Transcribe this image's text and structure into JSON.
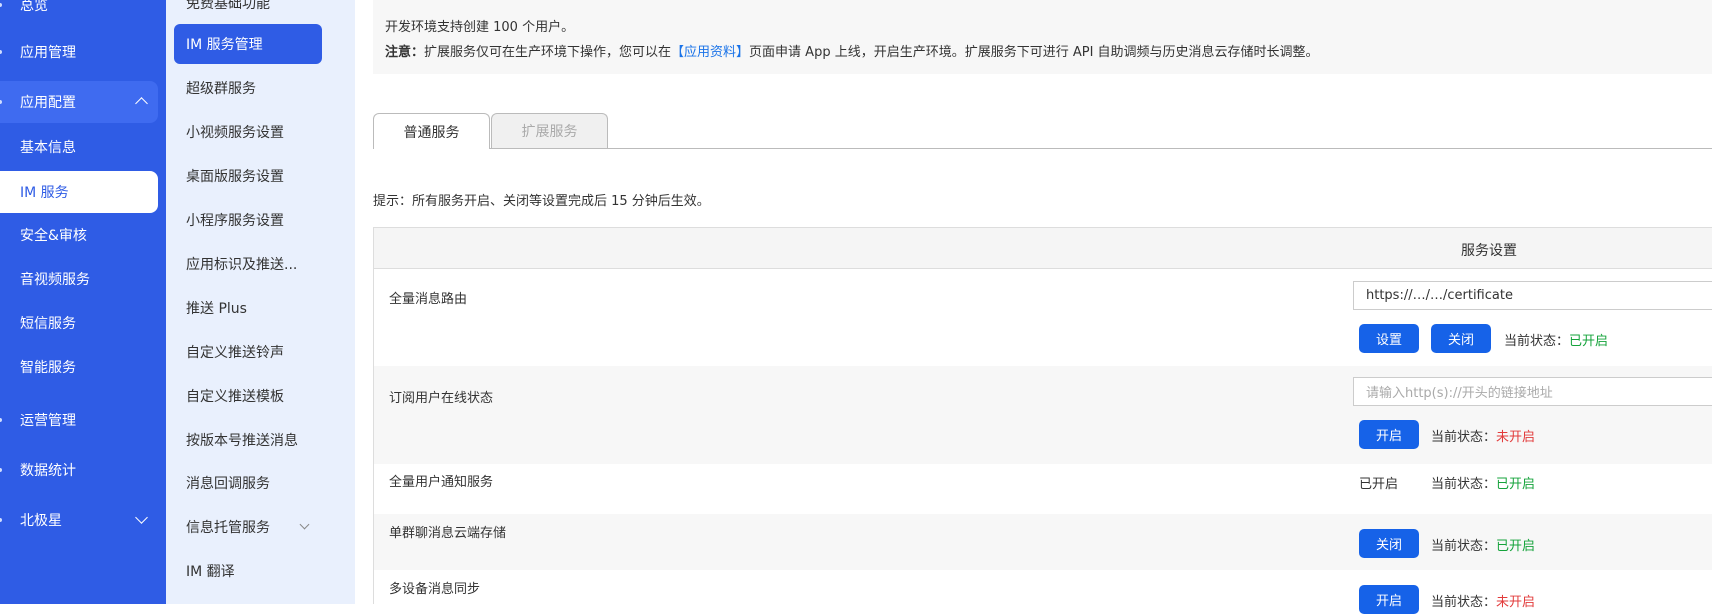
{
  "nav_left": {
    "items": [
      {
        "label": "总览"
      },
      {
        "label": "应用管理"
      },
      {
        "label": "应用配置"
      },
      {
        "label": "基本信息"
      },
      {
        "label": "IM 服务"
      },
      {
        "label": "安全&审核"
      },
      {
        "label": "音视频服务"
      },
      {
        "label": "短信服务"
      },
      {
        "label": "智能服务"
      },
      {
        "label": "运营管理"
      },
      {
        "label": "数据统计"
      },
      {
        "label": "北极星"
      }
    ]
  },
  "nav_sub": {
    "items": [
      {
        "label": "免费基础功能"
      },
      {
        "label": "IM 服务管理"
      },
      {
        "label": "超级群服务"
      },
      {
        "label": "小视频服务设置"
      },
      {
        "label": "桌面版服务设置"
      },
      {
        "label": "小程序服务设置"
      },
      {
        "label": "应用标识及推送..."
      },
      {
        "label": "推送 Plus"
      },
      {
        "label": "自定义推送铃声"
      },
      {
        "label": "自定义推送模板"
      },
      {
        "label": "按版本号推送消息"
      },
      {
        "label": "消息回调服务"
      },
      {
        "label": "信息托管服务"
      },
      {
        "label": "IM 翻译"
      }
    ]
  },
  "notice": {
    "line1": "开发环境支持创建 100 个用户。",
    "line2_strong": "注意：",
    "line2_a": "扩展服务仅可在生产环境下操作，您可以在",
    "line2_link": "【应用资料】",
    "line2_b": "页面申请 App 上线，开启生产环境。扩展服务下可进行 API 自助调频与历史消息云存储时长调整。"
  },
  "tabs": [
    {
      "label": "普通服务"
    },
    {
      "label": "扩展服务"
    }
  ],
  "tip": "提示：所有服务开启、关闭等设置完成后 15 分钟后生效。",
  "table": {
    "header": "服务设置",
    "status_label": "当前状态：",
    "rows": [
      {
        "name": "全量消息路由",
        "input_value": "https://…/…/certificate",
        "btn1": "设置",
        "btn2": "关闭",
        "status": "已开启"
      },
      {
        "name": "订阅用户在线状态",
        "input_placeholder": "请输入http(s)://开头的链接地址",
        "btn1": "开启",
        "status": "未开启"
      },
      {
        "name": "全量用户通知服务",
        "plain": "已开启",
        "status": "已开启"
      },
      {
        "name": "单群聊消息云端存储",
        "btn1": "关闭",
        "status": "已开启"
      },
      {
        "name": "多设备消息同步",
        "btn1": "开启",
        "status": "未开启"
      }
    ]
  },
  "colors": {
    "primary": "#2f5ce5",
    "button": "#1662e8",
    "on": "#15a33b",
    "off": "#e23b3b"
  }
}
